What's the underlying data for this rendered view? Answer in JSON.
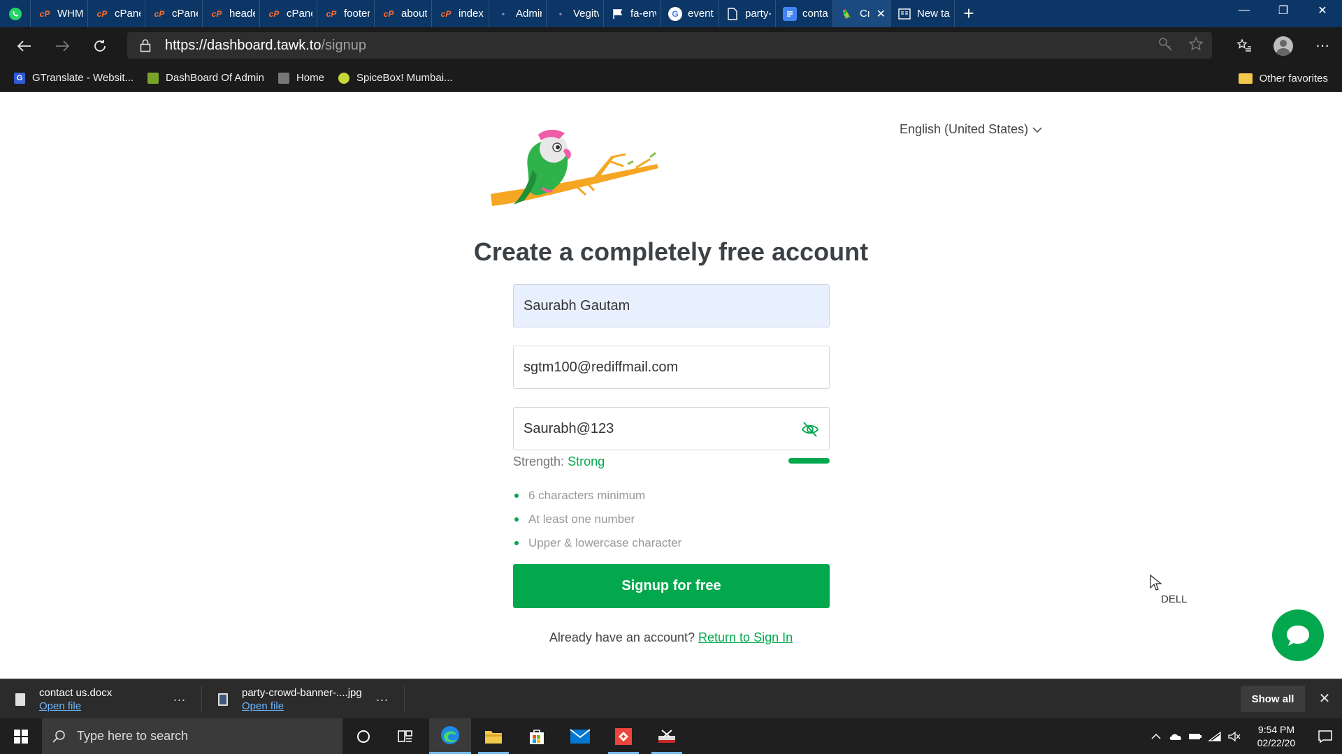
{
  "browser": {
    "tabs": [
      {
        "title": "",
        "icon": "whatsapp-icon",
        "color": "#25d366"
      },
      {
        "title": "WHM [I",
        "icon": "cpanel-icon",
        "color": "#ff6c2c"
      },
      {
        "title": "cPanel -",
        "icon": "cpanel-icon",
        "color": "#ff6c2c"
      },
      {
        "title": "cPanel F",
        "icon": "cpanel-icon",
        "color": "#ff6c2c"
      },
      {
        "title": "header.",
        "icon": "cpanel-icon",
        "color": "#ff6c2c"
      },
      {
        "title": "cPanel F",
        "icon": "cpanel-icon",
        "color": "#ff6c2c"
      },
      {
        "title": "footer.p",
        "icon": "cpanel-icon",
        "color": "#ff6c2c"
      },
      {
        "title": "about.p",
        "icon": "cpanel-icon",
        "color": "#ff6c2c"
      },
      {
        "title": "index.pl",
        "icon": "cpanel-icon",
        "color": "#ff6c2c"
      },
      {
        "title": "Admin (",
        "icon": "site-icon",
        "color": "#2b2b8f"
      },
      {
        "title": "Vegitva",
        "icon": "site-icon",
        "color": "#2b2b8f"
      },
      {
        "title": "fa-enve",
        "icon": "flag-icon",
        "color": "#ffffff"
      },
      {
        "title": "event p",
        "icon": "google-icon",
        "color": "#4285f4"
      },
      {
        "title": "party-cr",
        "icon": "file-icon",
        "color": "#ffffff"
      },
      {
        "title": "contact",
        "icon": "docs-icon",
        "color": "#4285f4"
      },
      {
        "title": "Cre",
        "icon": "tawk-icon",
        "color": "#03a84e",
        "active": true
      },
      {
        "title": "New tal",
        "icon": "newtab-icon",
        "color": "#ffffff"
      }
    ],
    "url_host": "https://dashboard.tawk.to",
    "url_path": "/signup",
    "favorites": [
      {
        "label": "GTranslate - Websit...",
        "icon": "gtranslate-icon",
        "color": "#2e59d9"
      },
      {
        "label": "DashBoard Of Admin",
        "icon": "dashboard-icon",
        "color": "#7aa329"
      },
      {
        "label": "Home",
        "icon": "home-site-icon",
        "color": "#777777"
      },
      {
        "label": "SpiceBox! Mumbai...",
        "icon": "spicebox-icon",
        "color": "#c7d83a"
      }
    ],
    "other_favorites": "Other favorites"
  },
  "page": {
    "language": "English (United States)",
    "headline": "Create a completely free account",
    "name_value": "Saurabh Gautam",
    "email_value": "sgtm100@rediffmail.com",
    "password_value": "Saurabh@123",
    "strength_label": "Strength:",
    "strength_value": "Strong",
    "strength_level": 1.0,
    "requirements": [
      "6 characters minimum",
      "At least one number",
      "Upper & lowercase character"
    ],
    "signup_button": "Signup for free",
    "already_text": "Already have an account?",
    "signin_link": "Return to Sign In",
    "accent_color": "#03a84e",
    "overlay_text": "DELL"
  },
  "downloads": {
    "items": [
      {
        "name": "contact us.docx",
        "action": "Open file",
        "icon": "document-icon"
      },
      {
        "name": "party-crowd-banner-....jpg",
        "action": "Open file",
        "icon": "image-file-icon"
      }
    ],
    "more": "...",
    "show_all": "Show all"
  },
  "taskbar": {
    "search_placeholder": "Type here to search",
    "time": "9:54 PM",
    "date": "02/22/20"
  }
}
